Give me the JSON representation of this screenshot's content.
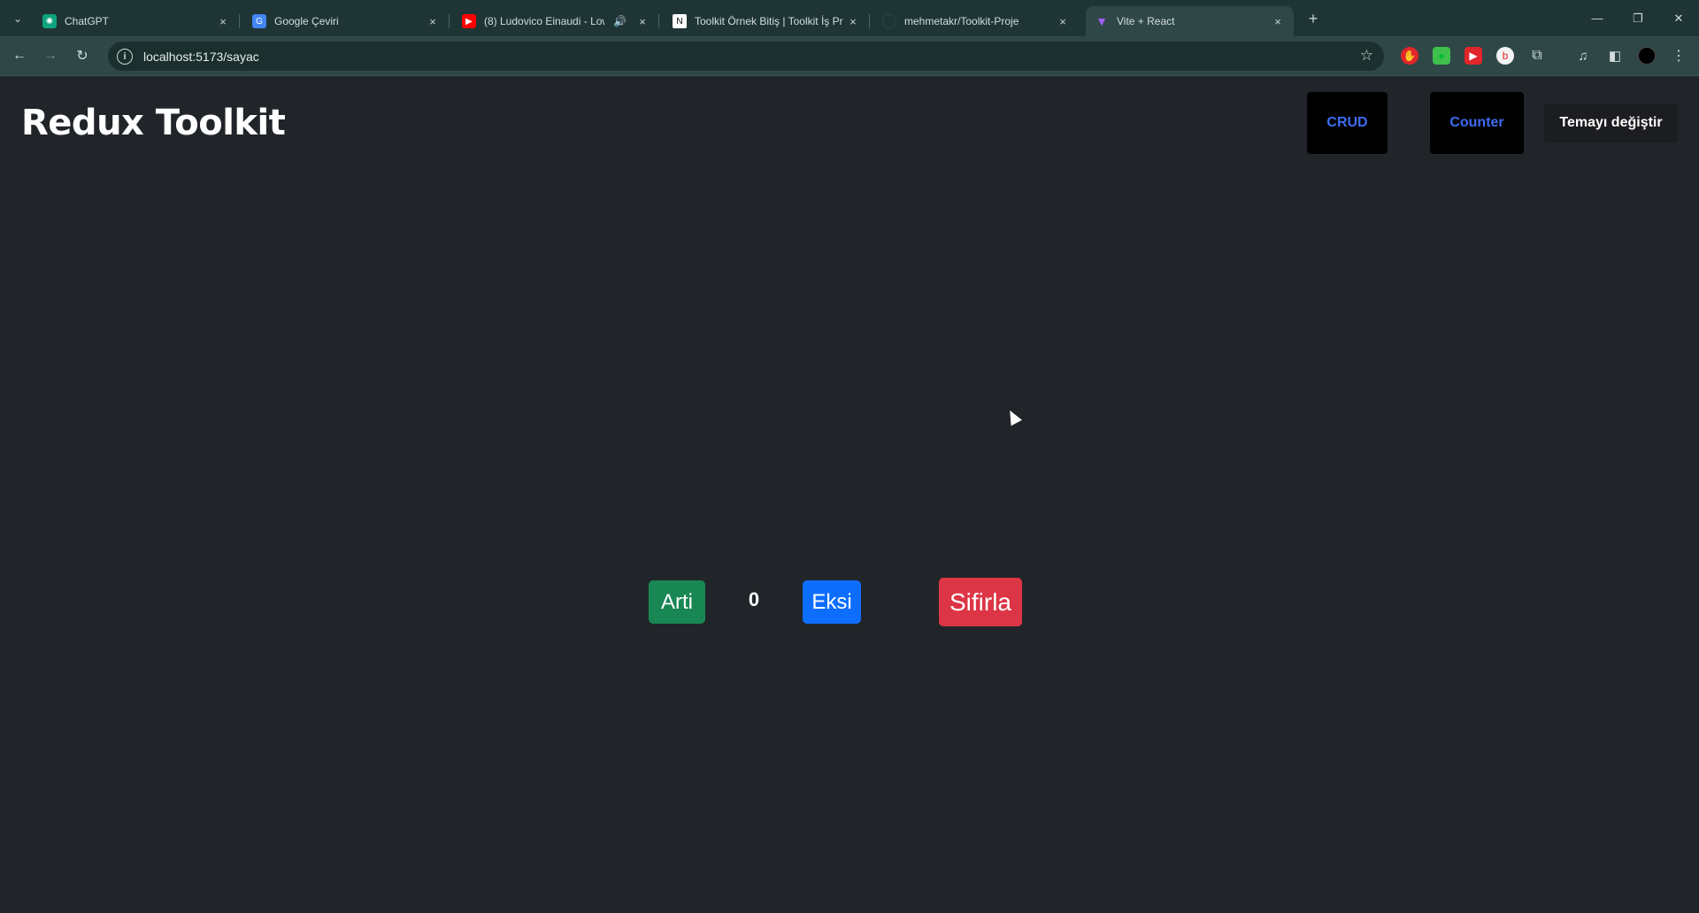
{
  "browser": {
    "tabs": [
      {
        "title": "ChatGPT",
        "favicon": "chatgpt-icon"
      },
      {
        "title": "Google Çeviri",
        "favicon": "google-translate-icon"
      },
      {
        "title": "(8) Ludovico Einaudi - Low",
        "favicon": "youtube-icon",
        "audio": "speaker-icon"
      },
      {
        "title": "Toolkit Örnek Bitiş | Toolkit İş Pr",
        "favicon": "notion-icon"
      },
      {
        "title": "mehmetakr/Toolkit-Proje",
        "favicon": "github-icon"
      },
      {
        "title": "Vite + React",
        "favicon": "vite-icon",
        "active": true
      }
    ],
    "new_tab_glyph": "+",
    "close_glyph": "×",
    "address": "localhost:5173/sayac"
  },
  "app": {
    "brand": "Redux Toolkit",
    "nav": {
      "crud": "CRUD",
      "counter": "Counter"
    },
    "theme_button": "Temayı değiştir",
    "counter": {
      "increment_label": "Arti",
      "value": "0",
      "decrement_label": "Eksi",
      "reset_label": "Sifirla"
    }
  },
  "colors": {
    "background": "#212529",
    "nav_link": "#3d6cf3",
    "success": "#198754",
    "primary": "#0d6efd",
    "danger": "#dc3545"
  }
}
